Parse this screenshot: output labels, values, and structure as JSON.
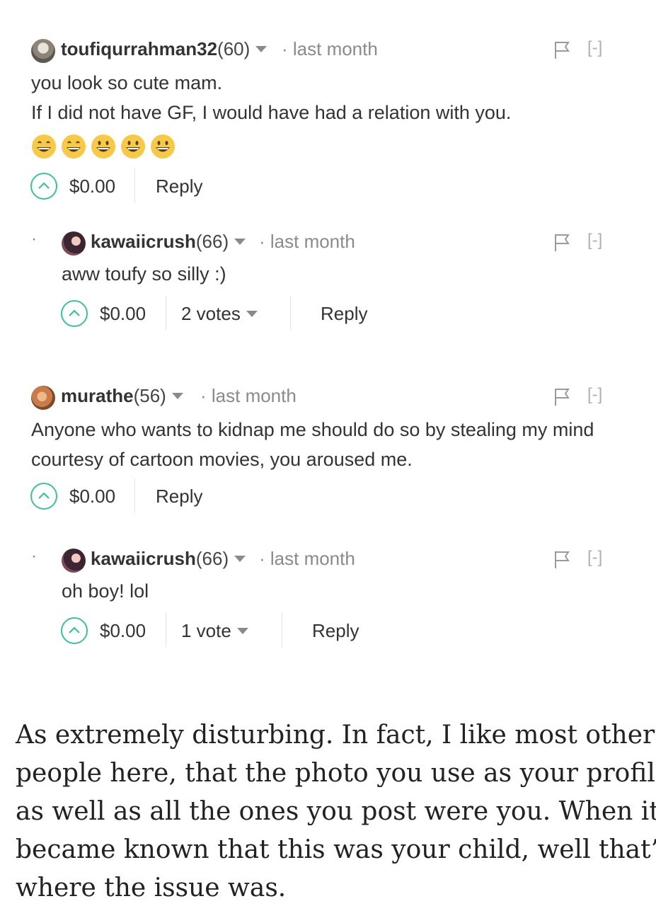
{
  "comments": [
    {
      "author": "toufiqurrahman32",
      "reputation": "(60)",
      "time": "· last month",
      "lines": [
        "you look so cute mam.",
        "If I did not have GF, I would have had a relation with you."
      ],
      "emoji_count": 5,
      "payout": "$0.00",
      "reply": "Reply",
      "collapse": "[-]"
    },
    {
      "author": "kawaiicrush",
      "reputation": "(66)",
      "time": "· last month",
      "lines": [
        "aww toufy so silly :)"
      ],
      "payout": "$0.00",
      "votes": "2 votes",
      "reply": "Reply",
      "collapse": "[-]"
    },
    {
      "author": "murathe",
      "reputation": "(56)",
      "time": "· last month",
      "lines": [
        "Anyone who wants to kidnap me should do so by stealing my mind",
        "courtesy of cartoon movies, you aroused me."
      ],
      "payout": "$0.00",
      "reply": "Reply",
      "collapse": "[-]"
    },
    {
      "author": "kawaiicrush",
      "reputation": "(66)",
      "time": "· last month",
      "lines": [
        "oh boy! lol"
      ],
      "payout": "$0.00",
      "votes": "1 vote",
      "reply": "Reply",
      "collapse": "[-]"
    }
  ],
  "nested_bullet": "·",
  "article": {
    "lines": [
      "As extremely disturbing. In fact, I like most other",
      "people here, that the photo you use as your profile",
      "as well as all the ones you post were you. When it",
      "became known that this was your child, well that’s",
      "where the issue was."
    ]
  },
  "colors": {
    "accent": "#3fbf9a",
    "muted": "#8a8a8a",
    "text": "#333333"
  },
  "icons": [
    "avatar",
    "caret-down-icon",
    "flag-icon",
    "upvote-icon",
    "grinning-emoji-icon"
  ]
}
